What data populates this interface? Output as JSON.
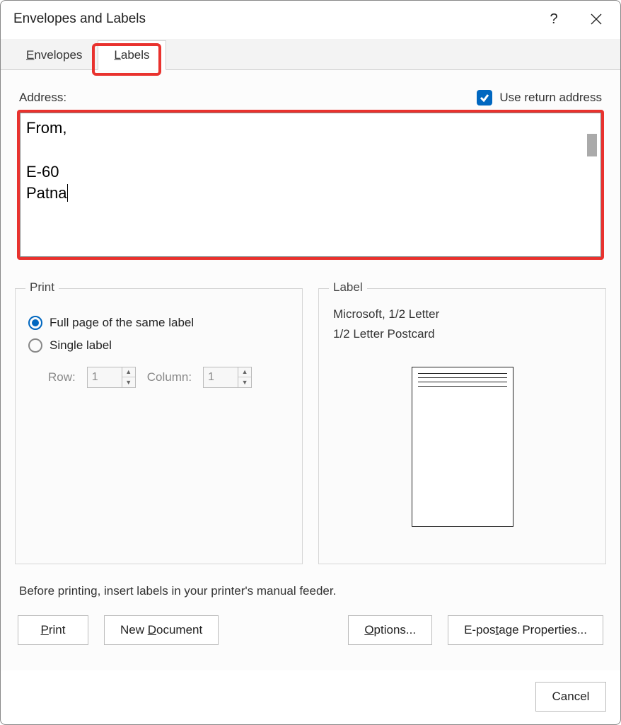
{
  "titlebar": {
    "title": "Envelopes and Labels",
    "help": "?",
    "close": "×"
  },
  "tabs": {
    "envelopes": "Envelopes",
    "labels": "Labels",
    "activeTab": "labels"
  },
  "address": {
    "label": "Address:",
    "useReturnLabel": "Use return address",
    "useReturnChecked": true,
    "value": "From,\n\nE-60\nPatna"
  },
  "printGroup": {
    "legend": "Print",
    "fullPageLabel": "Full page of the same label",
    "singleLabel": "Single label",
    "selected": "full",
    "rowLabel": "Row:",
    "rowValue": "1",
    "colLabel": "Column:",
    "colValue": "1"
  },
  "labelGroup": {
    "legend": "Label",
    "line1": "Microsoft, 1/2 Letter",
    "line2": "1/2 Letter Postcard"
  },
  "footerNote": "Before printing, insert labels in your printer's manual feeder.",
  "buttons": {
    "print": "Print",
    "newDocument": "New Document",
    "options": "Options...",
    "epostage": "E-postage Properties...",
    "cancel": "Cancel"
  }
}
